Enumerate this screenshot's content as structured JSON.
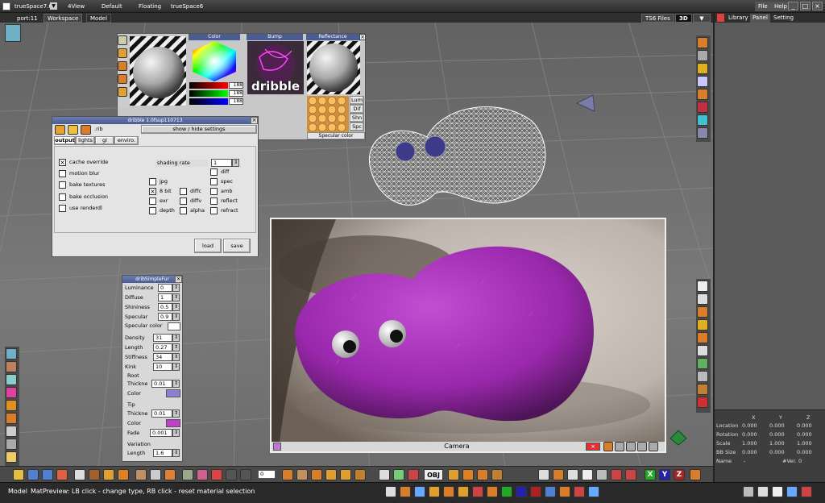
{
  "app": {
    "title": "trueSpace7.6",
    "menu_tabs": [
      "4View",
      "Default",
      "Floating",
      "trueSpace6"
    ],
    "top_right": {
      "file": "File",
      "help": "Help"
    }
  },
  "workspace": {
    "port_label": "port:11",
    "tabs": [
      "Workspace",
      "Model"
    ],
    "ts6_files": "TS6 Files",
    "view_mode": "3D"
  },
  "right_panel": {
    "tabs": [
      "Library",
      "Panel",
      "Setting"
    ],
    "props": {
      "headers": [
        "X",
        "Y",
        "Z"
      ],
      "rows": [
        {
          "label": "Location",
          "values": [
            "0.000",
            "0.000",
            "0.000"
          ]
        },
        {
          "label": "Rotation",
          "values": [
            "0.000",
            "0.000",
            "0.000"
          ]
        },
        {
          "label": "Scale",
          "values": [
            "1.000",
            "1.000",
            "1.000"
          ]
        },
        {
          "label": "BB Size",
          "values": [
            "0.000",
            "0.000",
            "0.000"
          ]
        }
      ],
      "name_label": "Name",
      "name_value": "-",
      "ver_label": "#Ver.",
      "ver_value": "0"
    }
  },
  "material_editor": {
    "color_title": "Color",
    "bump_title": "Bump",
    "reflectance_title": "Reflectance",
    "rgb_values": [
      "188",
      "188",
      "188"
    ],
    "bump_text": "dribble",
    "refl_buttons": [
      "Lum",
      "Dif",
      "Shn",
      "Spc"
    ],
    "specular_label": "Specular color"
  },
  "dribble_panel": {
    "title": "dribble 1.0fsup110713",
    "rib_label": ".rib",
    "show_hide": "show / hide settings",
    "tabs": [
      "output",
      "lights",
      "gi",
      "enviro."
    ],
    "checkboxes": [
      {
        "label": "cache override",
        "checked": true
      },
      {
        "label": "motion blur",
        "checked": false
      },
      {
        "label": "bake textures",
        "checked": false
      },
      {
        "label": "bake occlusion",
        "checked": false
      },
      {
        "label": "use renderdl",
        "checked": false
      }
    ],
    "shading_rate_label": "shading rate",
    "shading_rate_value": "1",
    "format_checks": [
      {
        "label": "jpg",
        "checked": false
      },
      {
        "label": "8 bit",
        "checked": true
      },
      {
        "label": "exr",
        "checked": false
      },
      {
        "label": "depth",
        "checked": false
      }
    ],
    "mid_checks": [
      {
        "label": "diffc",
        "checked": false
      },
      {
        "label": "diffv",
        "checked": false
      },
      {
        "label": "alpha",
        "checked": false
      }
    ],
    "aov_checks": [
      {
        "label": "diff",
        "checked": false
      },
      {
        "label": "spec",
        "checked": false
      },
      {
        "label": "amb",
        "checked": false
      },
      {
        "label": "reflect",
        "checked": false
      },
      {
        "label": "refract",
        "checked": false
      }
    ],
    "load_label": "load",
    "save_label": "save"
  },
  "fur_panel": {
    "title": "dribSimpleFur",
    "params_a": [
      {
        "label": "Luminance",
        "value": "0"
      },
      {
        "label": "Diffuse",
        "value": "1"
      },
      {
        "label": "Shininess",
        "value": "0.5"
      },
      {
        "label": "Specular",
        "value": "0.9"
      }
    ],
    "specular_color_label": "Specular color",
    "params_b": [
      {
        "label": "Density",
        "value": "31"
      },
      {
        "label": "Length",
        "value": "0.27"
      },
      {
        "label": "Stiffness",
        "value": "34"
      },
      {
        "label": "Kink",
        "value": "10"
      }
    ],
    "root_label": "Root",
    "root_thick_label": "Thickne",
    "root_thick_value": "0.01",
    "root_color_label": "Color",
    "root_color": "#8a7fd0",
    "tip_label": "Tip",
    "tip_thick_label": "Thickne",
    "tip_thick_value": "0.01",
    "tip_color_label": "Color",
    "tip_color": "#c040c8",
    "fade_label": "Fade",
    "fade_value": "0.001",
    "variation_label": "Variation",
    "var_length_label": "Length",
    "var_length_value": "1.6"
  },
  "camera_window": {
    "title": "Camera"
  },
  "status": {
    "mode": "Model",
    "message": "MatPreview: LB click - change type, RB click - reset material selection"
  },
  "bottom_toolbar": {
    "obj_label": "OBJ",
    "frame_value": "0"
  },
  "colors": {
    "fur": "#a22eb4",
    "panel_bg": "#e4e4e4",
    "title_blue": "#4a5c90",
    "viewport_bg": "#6e6e6e"
  }
}
